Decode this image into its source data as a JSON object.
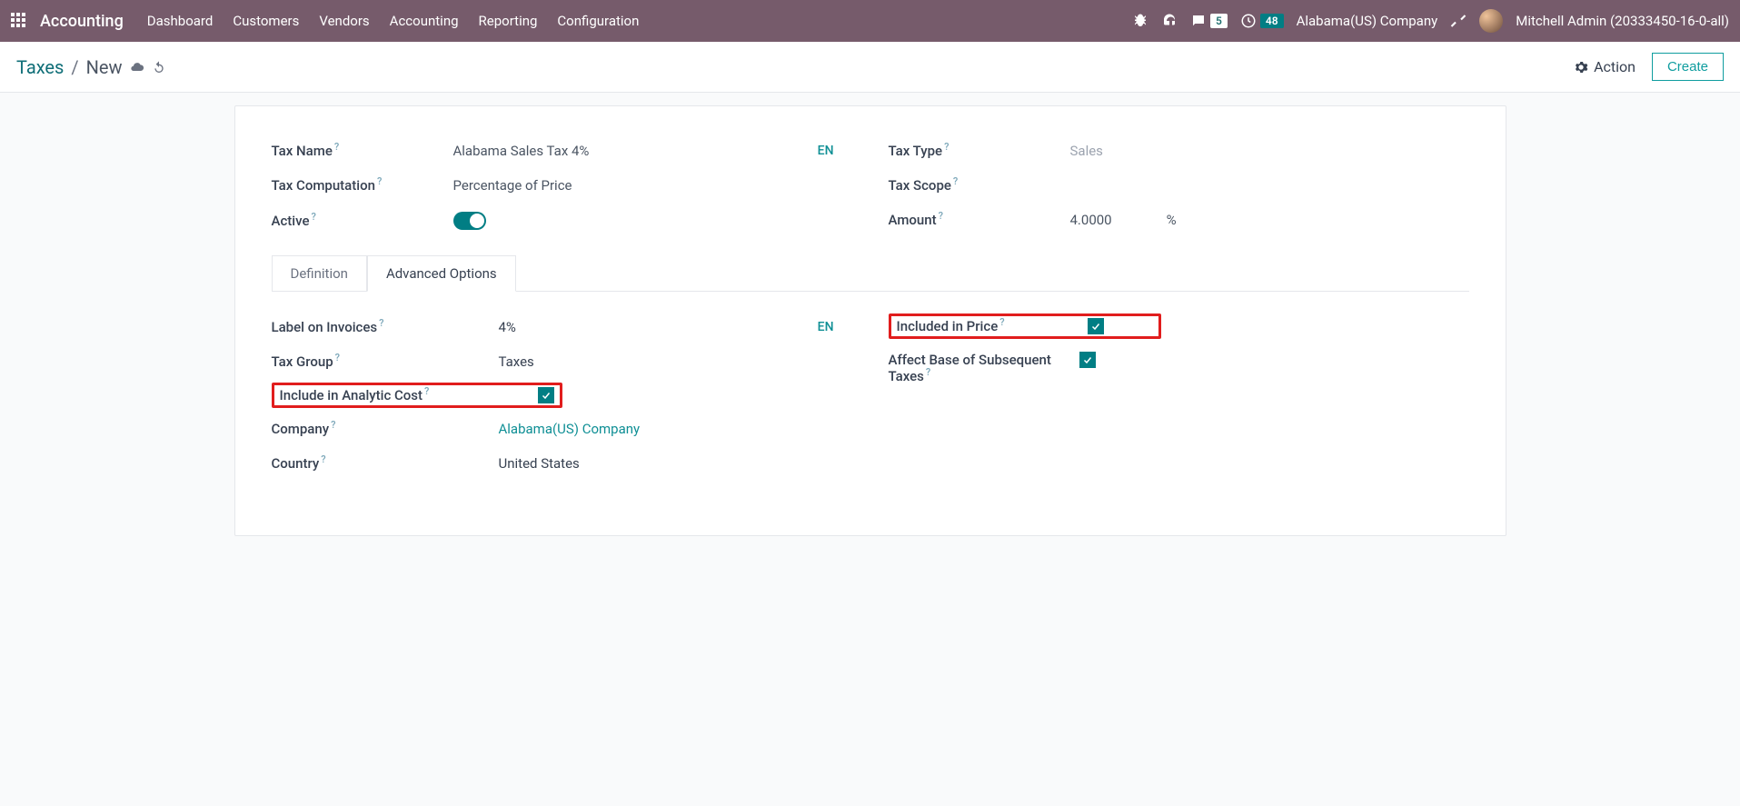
{
  "nav": {
    "brand": "Accounting",
    "links": [
      "Dashboard",
      "Customers",
      "Vendors",
      "Accounting",
      "Reporting",
      "Configuration"
    ],
    "chat_badge": "5",
    "clock_badge": "48",
    "company": "Alabama(US) Company",
    "user": "Mitchell Admin (20333450-16-0-all)"
  },
  "breadcrumb": {
    "root": "Taxes",
    "current": "New"
  },
  "actions": {
    "action_label": "Action",
    "create_label": "Create"
  },
  "form": {
    "tax_name_label": "Tax Name",
    "tax_name_value": "Alabama Sales Tax 4%",
    "tax_computation_label": "Tax Computation",
    "tax_computation_value": "Percentage of Price",
    "active_label": "Active",
    "lang_tag": "EN",
    "tax_type_label": "Tax Type",
    "tax_type_value": "Sales",
    "tax_scope_label": "Tax Scope",
    "amount_label": "Amount",
    "amount_value": "4.0000",
    "amount_unit": "%"
  },
  "tabs": {
    "definition": "Definition",
    "advanced": "Advanced Options"
  },
  "adv": {
    "label_invoices_label": "Label on Invoices",
    "label_invoices_value": "4%",
    "tax_group_label": "Tax Group",
    "tax_group_value": "Taxes",
    "include_analytic_label": "Include in Analytic Cost",
    "company_label": "Company",
    "company_value": "Alabama(US) Company",
    "country_label": "Country",
    "country_value": "United States",
    "included_price_label": "Included in Price",
    "affect_base_label": "Affect Base of Subsequent Taxes",
    "lang_tag": "EN"
  }
}
